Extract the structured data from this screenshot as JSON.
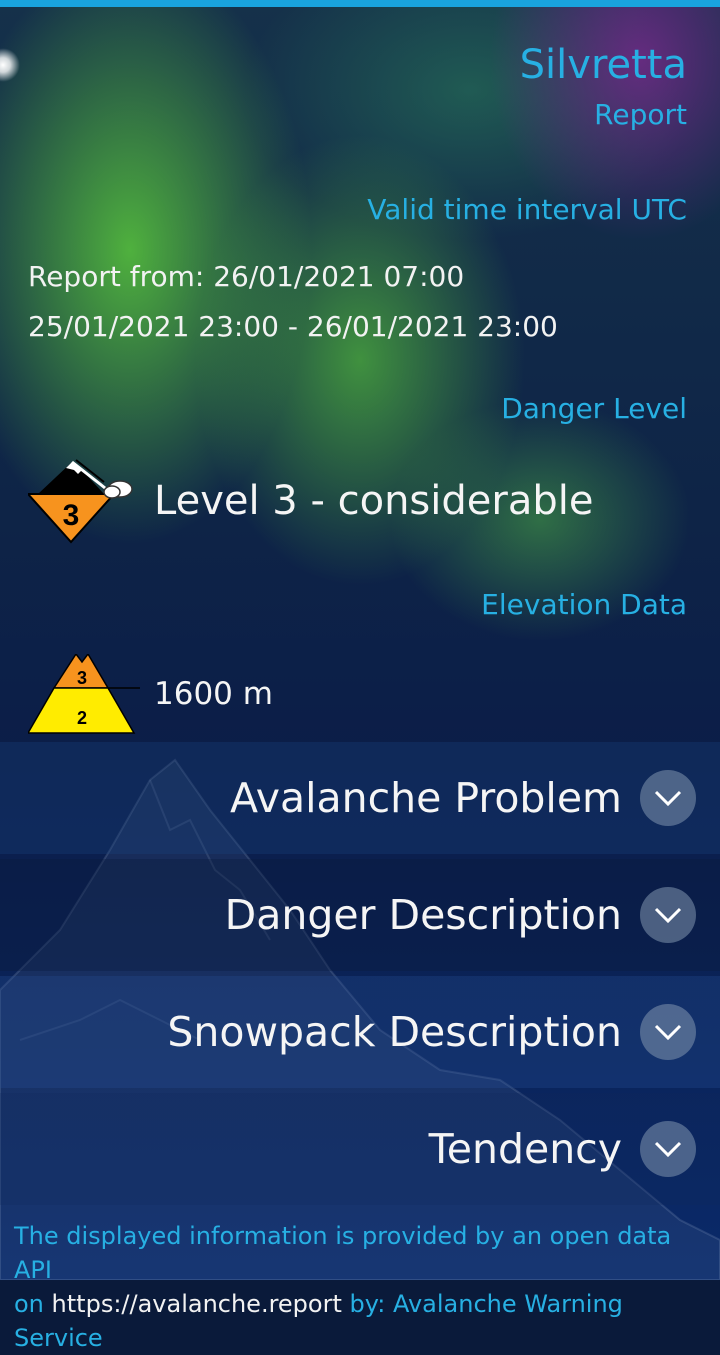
{
  "header": {
    "region": "Silvretta",
    "subtitle": "Report"
  },
  "validity": {
    "section_label": "Valid time interval UTC",
    "report_from": "Report from: 26/01/2021 07:00",
    "interval": "25/01/2021 23:00 - 26/01/2021 23:00"
  },
  "danger": {
    "section_label": "Danger Level",
    "icon_level": "3",
    "text": "Level 3 - considerable"
  },
  "elevation": {
    "section_label": "Elevation Data",
    "upper_level": "3",
    "lower_level": "2",
    "text": "1600 m"
  },
  "sections": [
    {
      "label": "Avalanche Problem",
      "icon": "chevron-down-icon"
    },
    {
      "label": "Danger Description",
      "icon": "chevron-down-icon"
    },
    {
      "label": "Snowpack Description",
      "icon": "chevron-down-icon"
    },
    {
      "label": "Tendency",
      "icon": "chevron-down-icon"
    }
  ],
  "footer": {
    "text1": "The displayed information is provided by an open data API",
    "text2": "on",
    "link": "https://avalanche.report",
    "text3": "by: Avalanche Warning Service"
  },
  "colors": {
    "accent": "#27b0e3",
    "top_bar": "#19a3de",
    "danger_orange": "#f7931e",
    "danger_yellow": "#ffec00"
  }
}
